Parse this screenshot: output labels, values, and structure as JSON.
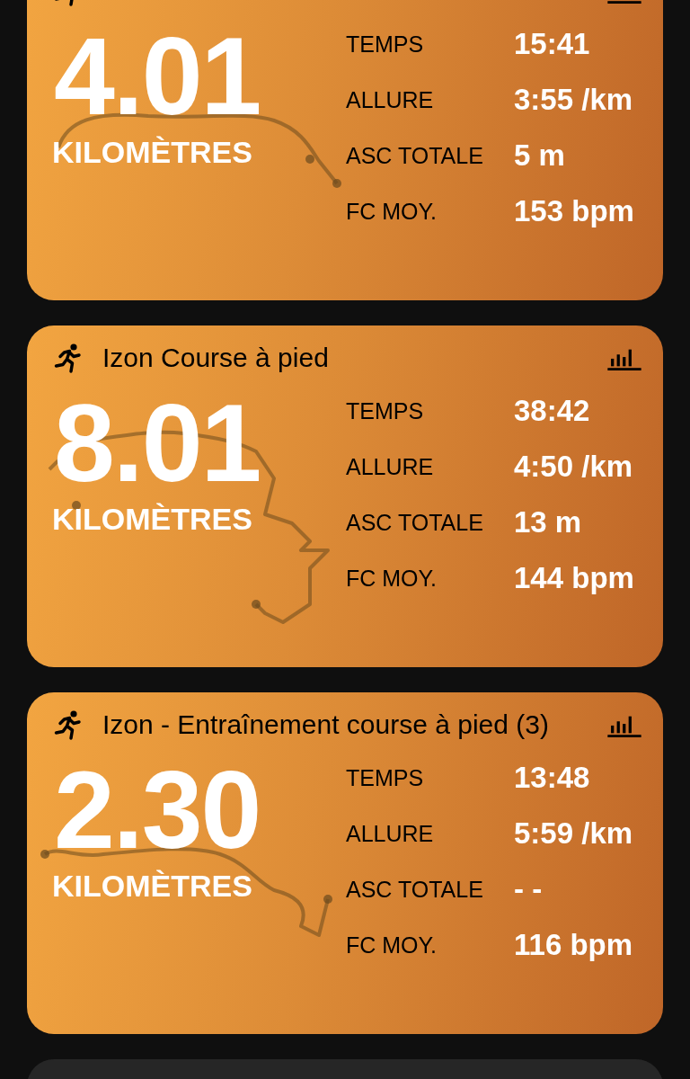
{
  "workouts": [
    {
      "distance": "4.01",
      "unit": "KILOMÈTRES",
      "stats": [
        {
          "label": "TEMPS",
          "value": "15:41"
        },
        {
          "label": "ALLURE",
          "value": "3:55 /km"
        },
        {
          "label": "ASC TOTALE",
          "value": "5 m"
        },
        {
          "label": "FC MOY.",
          "value": "153 bpm"
        }
      ]
    },
    {
      "title": "Izon Course à pied",
      "distance": "8.01",
      "unit": "KILOMÈTRES",
      "stats": [
        {
          "label": "TEMPS",
          "value": "38:42"
        },
        {
          "label": "ALLURE",
          "value": "4:50 /km"
        },
        {
          "label": "ASC TOTALE",
          "value": "13 m"
        },
        {
          "label": "FC MOY.",
          "value": "144 bpm"
        }
      ]
    },
    {
      "title": "Izon - Entraînement course à pied (3)",
      "distance": "2.30",
      "unit": "KILOMÈTRES",
      "stats": [
        {
          "label": "TEMPS",
          "value": "13:48"
        },
        {
          "label": "ALLURE",
          "value": "5:59 /km"
        },
        {
          "label": "ASC TOTALE",
          "value": "- -"
        },
        {
          "label": "FC MOY.",
          "value": "116 bpm"
        }
      ]
    }
  ]
}
